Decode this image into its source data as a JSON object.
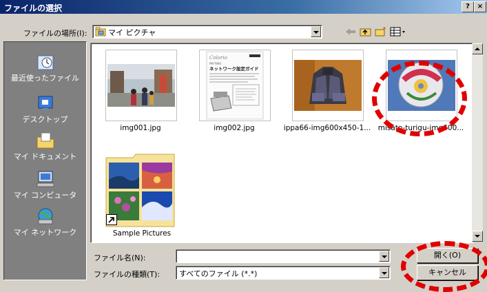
{
  "window": {
    "title": "ファイルの選択",
    "help_label": "?",
    "close_label": "×"
  },
  "toolbar": {
    "look_in_label": "ファイルの場所(I):",
    "look_in_value": "マイ ピクチャ",
    "icons": [
      "back-arrow-icon",
      "up-folder-icon",
      "new-folder-icon",
      "view-menu-icon"
    ]
  },
  "places": [
    {
      "label": "最近使ったファイル",
      "icon": "recent-clock-icon"
    },
    {
      "label": "デスクトップ",
      "icon": "desktop-icon"
    },
    {
      "label": "マイ ドキュメント",
      "icon": "my-documents-folder-icon"
    },
    {
      "label": "マイ コンピュータ",
      "icon": "my-computer-icon"
    },
    {
      "label": "マイ ネットワーク",
      "icon": "my-network-globe-icon"
    }
  ],
  "doc_thumb": {
    "brand": "Colorio",
    "model": "PM-T990",
    "heading": "ネットワーク設定ガイド"
  },
  "files": [
    {
      "name": "img001.jpg"
    },
    {
      "name": "img002.jpg"
    },
    {
      "name": "ippa66-img600x450-1..."
    },
    {
      "name": "misato-turigu-img600..."
    },
    {
      "name": "Sample Pictures"
    }
  ],
  "filename": {
    "label": "ファイル名(N):",
    "value": ""
  },
  "filetype": {
    "label": "ファイルの種類(T):",
    "value": "すべてのファイル (*.*)"
  },
  "buttons": {
    "open": "開く(O)",
    "cancel": "キャンセル"
  },
  "colors": {
    "title_bar": "#0a246a",
    "places_bar": "#808080",
    "annotation": "#e00000"
  }
}
